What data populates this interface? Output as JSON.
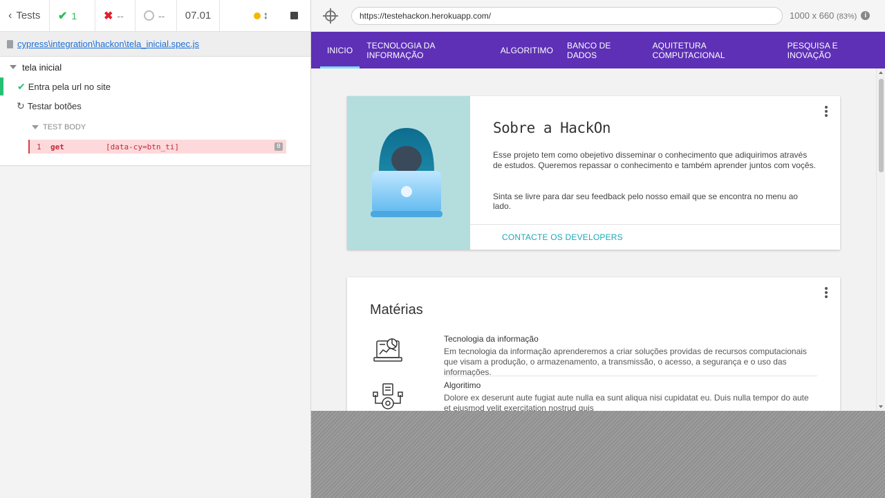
{
  "reporter": {
    "tests_label": "Tests",
    "passed": "1",
    "failed": "--",
    "pending": "--",
    "duration": "07.01",
    "spec_path": "cypress\\integration\\hackon\\tela_inicial.spec.js",
    "suite_title": "tela inicial",
    "tests": [
      {
        "title": "Entra pela url no site",
        "state": "passed"
      },
      {
        "title": "Testar botões",
        "state": "running"
      }
    ],
    "body_header": "TEST BODY",
    "command": {
      "number": "1",
      "name": "get",
      "message": "[data-cy=btn_ti]",
      "badge": "0"
    },
    "colors": {
      "passed": "#25c073",
      "failed": "#e0202e",
      "running_dot": "#f5b800"
    }
  },
  "aut": {
    "url": "https://testehackon.herokuapp.com/",
    "viewport": "1000 x 660",
    "scale": "(83%)",
    "info_icon": "i"
  },
  "site": {
    "nav": [
      "INICIO",
      "TECNOLOGIA DA INFORMAÇÃO",
      "ALGORITIMO",
      "BANCO DE DADOS",
      "AQUITETURA COMPUTACIONAL",
      "PESQUISA E INOVAÇÃO"
    ],
    "nav_color": "#5d30b6",
    "about": {
      "title": "Sobre a HackOn",
      "p1": "Esse projeto tem como obejetivo disseminar o conhecimento que adiquirimos através de estudos. Queremos repassar o conhecimento e também aprender juntos com voçês.",
      "p2": "Sinta se livre para dar seu feedback pelo nosso email que se encontra no menu ao lado.",
      "action": "CONTACTE OS DEVELOPERS"
    },
    "materias": {
      "title": "Matérias",
      "items": [
        {
          "title": "Tecnologia da informação",
          "desc": "Em tecnologia da informação aprenderemos a criar soluções providas de recursos computacionais que visam a produção, o armazenamento, a transmissão, o acesso, a segurança e o uso das informações."
        },
        {
          "title": "Algoritimo",
          "desc": "Dolore ex deserunt aute fugiat aute nulla ea sunt aliqua nisi cupidatat eu. Duis nulla tempor do aute et eiusmod velit exercitation nostrud quis"
        }
      ]
    }
  }
}
